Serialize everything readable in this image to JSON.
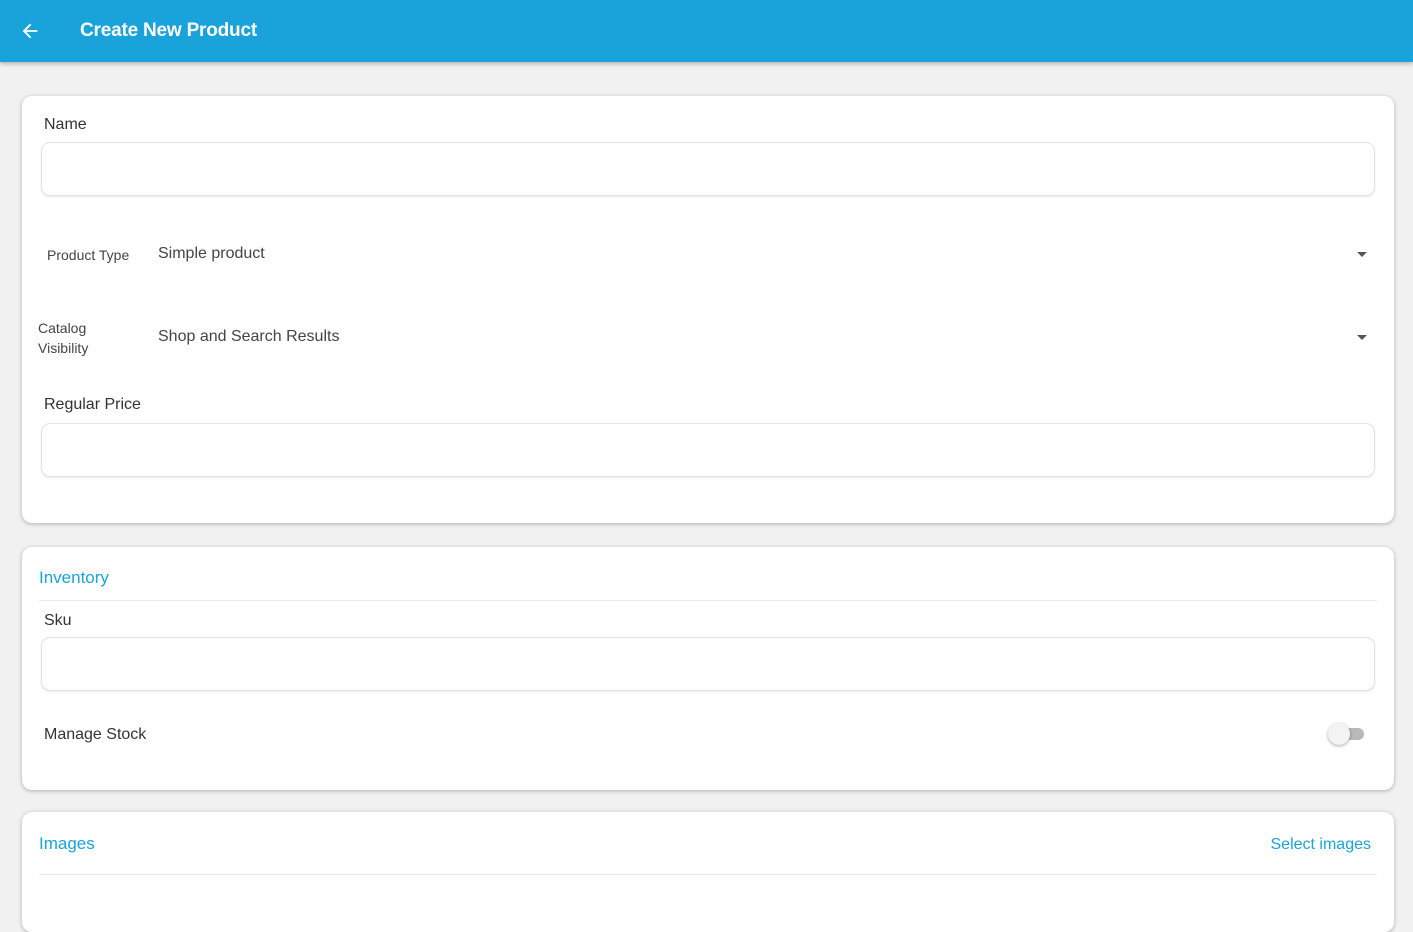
{
  "appbar": {
    "title": "Create New Product",
    "back_icon": "arrow-left-icon",
    "color": "#1aa3da"
  },
  "general": {
    "name_label": "Name",
    "name_value": "",
    "product_type_label": "Product Type",
    "product_type_value": "Simple product",
    "catalog_visibility_label_line1": "Catalog",
    "catalog_visibility_label_line2": "Visibility",
    "catalog_visibility_value": "Shop and Search Results",
    "regular_price_label": "Regular Price",
    "regular_price_value": ""
  },
  "inventory": {
    "title": "Inventory",
    "sku_label": "Sku",
    "sku_value": "",
    "manage_stock_label": "Manage Stock",
    "manage_stock_on": false
  },
  "images": {
    "title": "Images",
    "select_label": "Select images"
  },
  "colors": {
    "accent": "#1aa3da",
    "background": "#f1f1f1",
    "card": "#ffffff"
  }
}
